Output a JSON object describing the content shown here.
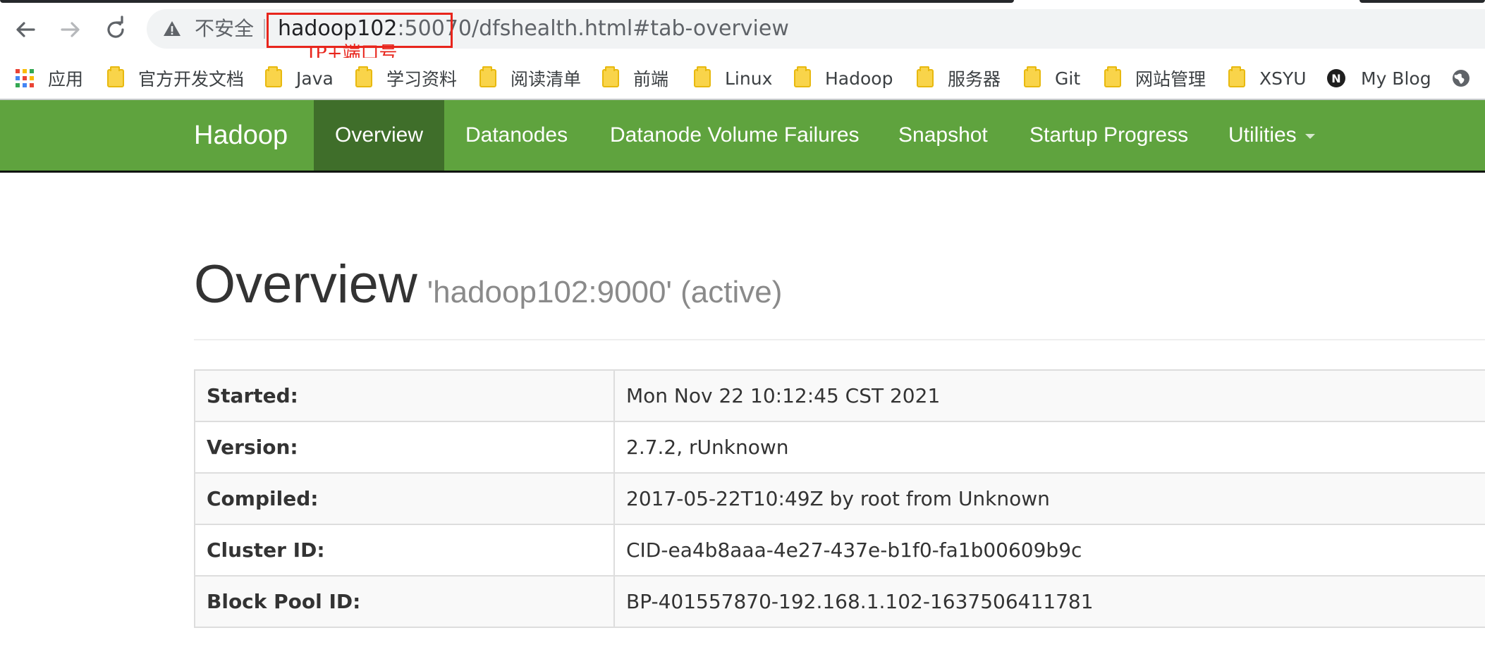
{
  "browser": {
    "security_label": "不安全",
    "url_host": "hadoop102",
    "url_rest": ":50070/dfshealth.html#tab-overview",
    "annotation": "IP+端口号",
    "bookmarks": [
      {
        "label": "应用"
      },
      {
        "label": "官方开发文档"
      },
      {
        "label": "Java"
      },
      {
        "label": "学习资料"
      },
      {
        "label": "阅读清单"
      },
      {
        "label": "前端"
      },
      {
        "label": "Linux"
      },
      {
        "label": "Hadoop"
      },
      {
        "label": "服务器"
      },
      {
        "label": "Git"
      },
      {
        "label": "网站管理"
      },
      {
        "label": "XSYU"
      },
      {
        "label": "My Blog"
      }
    ]
  },
  "navbar": {
    "brand": "Hadoop",
    "items": [
      {
        "label": "Overview"
      },
      {
        "label": "Datanodes"
      },
      {
        "label": "Datanode Volume Failures"
      },
      {
        "label": "Snapshot"
      },
      {
        "label": "Startup Progress"
      },
      {
        "label": "Utilities"
      }
    ]
  },
  "overview": {
    "title": "Overview",
    "subtitle": "'hadoop102:9000' (active)",
    "rows": [
      {
        "key": "Started:",
        "value": "Mon Nov 22 10:12:45 CST 2021"
      },
      {
        "key": "Version:",
        "value": "2.7.2, rUnknown"
      },
      {
        "key": "Compiled:",
        "value": "2017-05-22T10:49Z by root from Unknown"
      },
      {
        "key": "Cluster ID:",
        "value": "CID-ea4b8aaa-4e27-437e-b1f0-fa1b00609b9c"
      },
      {
        "key": "Block Pool ID:",
        "value": "BP-401557870-192.168.1.102-1637506411781"
      }
    ]
  },
  "colors": {
    "navbar_green": "#5fa33e",
    "navbar_active": "#3f6e2a",
    "annotation_red": "#e8251c"
  }
}
